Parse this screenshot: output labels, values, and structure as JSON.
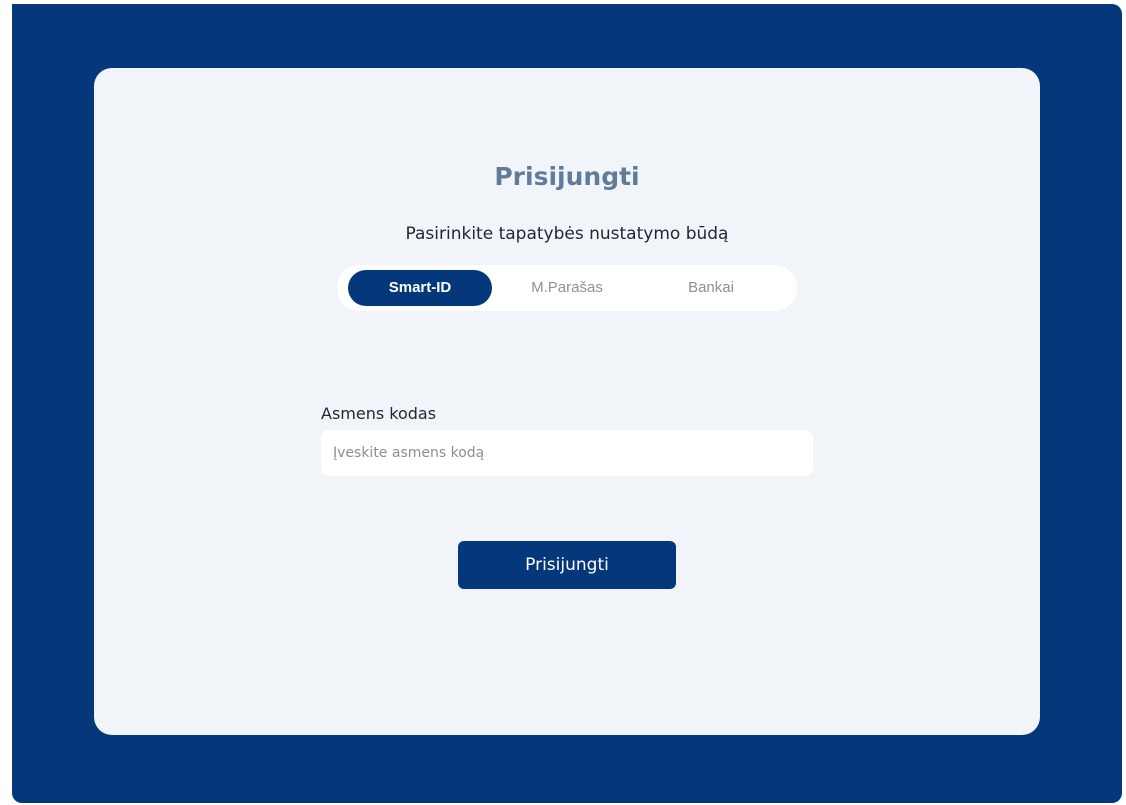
{
  "login": {
    "title": "Prisijungti",
    "subtitle": "Pasirinkite tapatybės nustatymo būdą",
    "methods": [
      {
        "label": "Smart-ID",
        "active": true
      },
      {
        "label": "M.Parašas",
        "active": false
      },
      {
        "label": "Bankai",
        "active": false
      }
    ],
    "personal_code": {
      "label": "Asmens kodas",
      "placeholder": "Įveskite asmens kodą",
      "value": ""
    },
    "submit_label": "Prisijungti"
  },
  "colors": {
    "frame": "#04387a",
    "card": "#f1f5fa",
    "title": "#5f7d99",
    "accent": "#04387a"
  }
}
